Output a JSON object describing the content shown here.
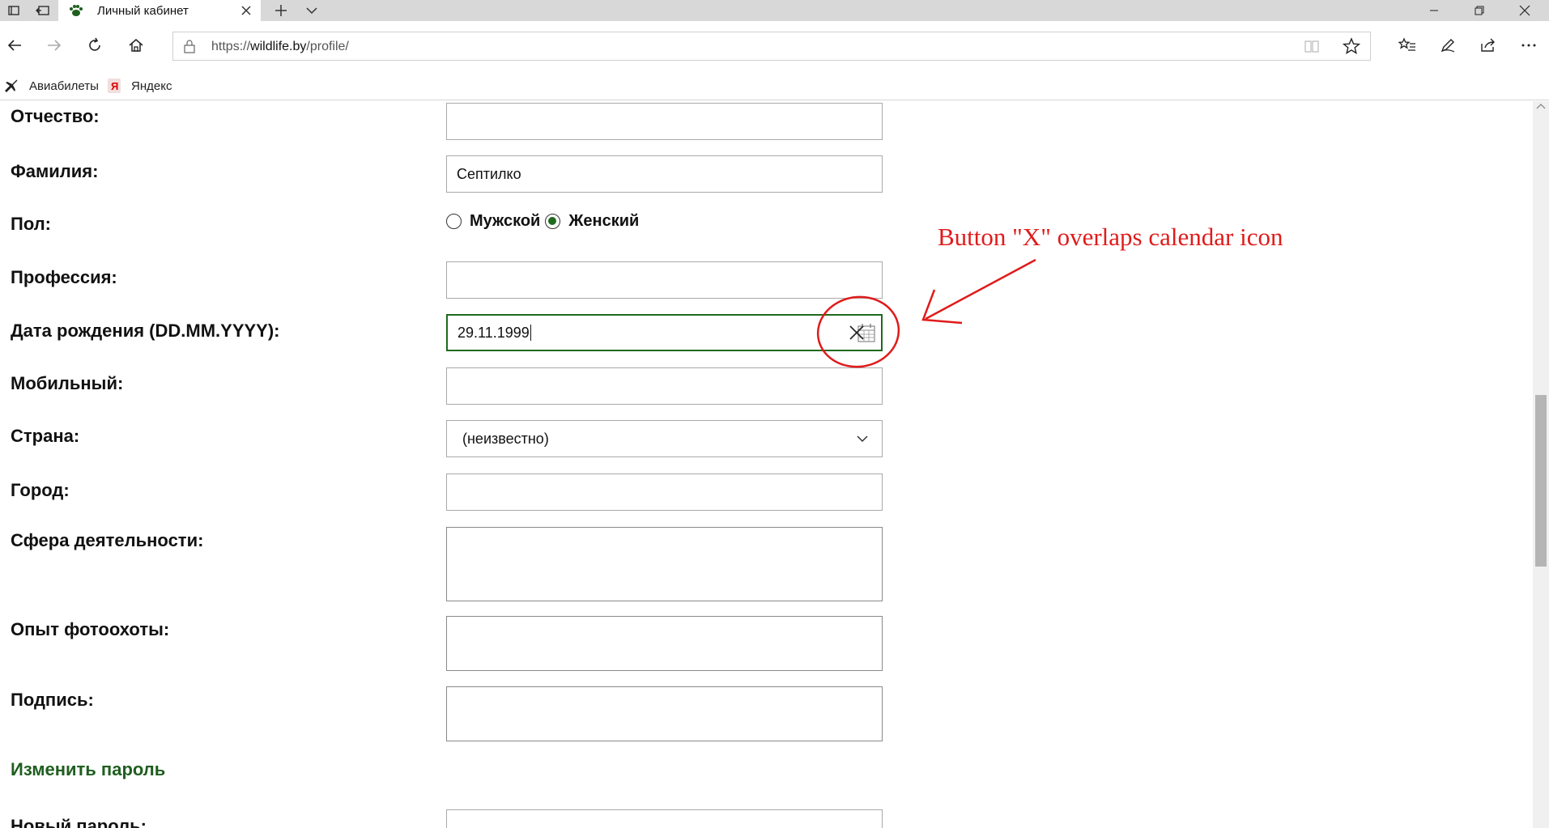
{
  "browser": {
    "tab_title": "Личный кабинет",
    "url_scheme": "https://",
    "url_host": "wildlife.by",
    "url_path": "/profile/",
    "favorites": [
      {
        "label": "Авиабилеты",
        "icon": "plane-icon"
      },
      {
        "label": "Яндекс",
        "icon": "yandex-icon"
      }
    ]
  },
  "form": {
    "patronymic_label": "Отчество:",
    "patronymic_value": "",
    "surname_label": "Фамилия:",
    "surname_value": "Септилко",
    "gender_label": "Пол:",
    "gender_options": [
      "Мужской",
      "Женский"
    ],
    "gender_selected": "Женский",
    "profession_label": "Профессия:",
    "birthdate_label": "Дата рождения (DD.MM.YYYY):",
    "birthdate_value": "29.11.1999",
    "mobile_label": "Мобильный:",
    "country_label": "Страна:",
    "country_value": "(неизвестно)",
    "city_label": "Город:",
    "activity_label": "Сфера деятельности:",
    "experience_label": "Опыт фотоохоты:",
    "signature_label": "Подпись:",
    "change_password_link": "Изменить пароль",
    "new_password_label": "Новый пароль:"
  },
  "annotation": {
    "text": "Button \"X\" overlaps calendar icon",
    "color": "#e01b1b"
  },
  "colors": {
    "accent_green": "#1f6a1f",
    "link_green": "#1f5e1f"
  }
}
